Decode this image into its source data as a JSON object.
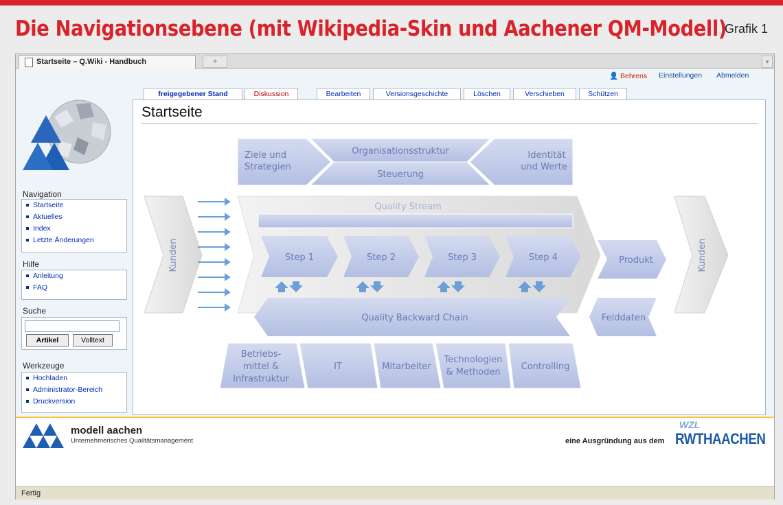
{
  "headline": "Die Navigationsebene (mit Wikipedia-Skin und Aachener QM-Modell)",
  "grafik": "Grafik 1",
  "browser": {
    "tab_title": "Startseite – Q.Wiki - Handbuch",
    "newtab_symbol": "+",
    "status": "Fertig"
  },
  "userlinks": {
    "user": "Behrens",
    "settings": "Einstellungen",
    "logout": "Abmelden"
  },
  "pagetabs": [
    "freigegebener Stand",
    "Diskussion",
    "Bearbeiten",
    "Versionsgeschichte",
    "Löschen",
    "Verschieben",
    "Schützen"
  ],
  "page_title": "Startseite",
  "sidebar": {
    "navigation_label": "Navigation",
    "navigation": [
      "Startseite",
      "Aktuelles",
      "Index",
      "Letzte Änderungen"
    ],
    "help_label": "Hilfe",
    "help": [
      "Anleitung",
      "FAQ"
    ],
    "search_label": "Suche",
    "search_value": "",
    "search_article": "Artikel",
    "search_fulltext": "Volltext",
    "tools_label": "Werkzeuge",
    "tools": [
      "Hochladen",
      "Administrator-Bereich",
      "Druckversion"
    ]
  },
  "diagram": {
    "top_left": "Ziele und Strategien",
    "top_mid_top": "Organisationsstruktur",
    "top_mid_bottom": "Steuerung",
    "top_right": "Identität und Werte",
    "left_customers": "Kunden",
    "right_customers": "Kunden",
    "quality_stream": "Quality Stream",
    "steps": [
      "Step 1",
      "Step 2",
      "Step 3",
      "Step 4"
    ],
    "product": "Produkt",
    "field_data": "Felddaten",
    "backward_chain": "Quality Backward Chain",
    "bottom": [
      "Betriebs-mittel & Infrastruktur",
      "IT",
      "Mitarbeiter",
      "Technologien & Methoden",
      "Controlling"
    ]
  },
  "footer": {
    "logo_name": "modell aachen",
    "logo_sub": "Unternehmerisches Qualitätsmanagement",
    "ausgruendung": "eine Ausgründung aus dem",
    "wzl": "WZL",
    "rwth": "RWTHAACHEN"
  },
  "colors": {
    "accent": "#d8232a",
    "link": "#002bb8",
    "diagram_fill": "#bcc6e6",
    "diagram_text": "#6b7ab5"
  }
}
